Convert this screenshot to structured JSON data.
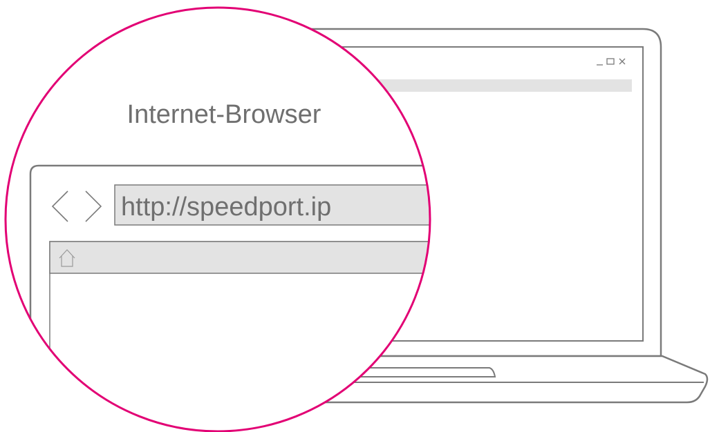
{
  "magnifier": {
    "title": "Internet-Browser",
    "address_bar": {
      "value": "http://speedport.ip"
    },
    "nav": {
      "back_icon": "chevron-left-icon",
      "forward_icon": "chevron-right-icon",
      "home_icon": "home-icon"
    }
  },
  "laptop_window": {
    "controls": {
      "minimize_icon": "minimize-icon",
      "maximize_icon": "maximize-icon",
      "close_icon": "close-icon"
    }
  },
  "colors": {
    "accent": "#e20074",
    "line": "#7a7a7a",
    "text": "#6f6f6f",
    "fill": "#e3e3e3"
  }
}
